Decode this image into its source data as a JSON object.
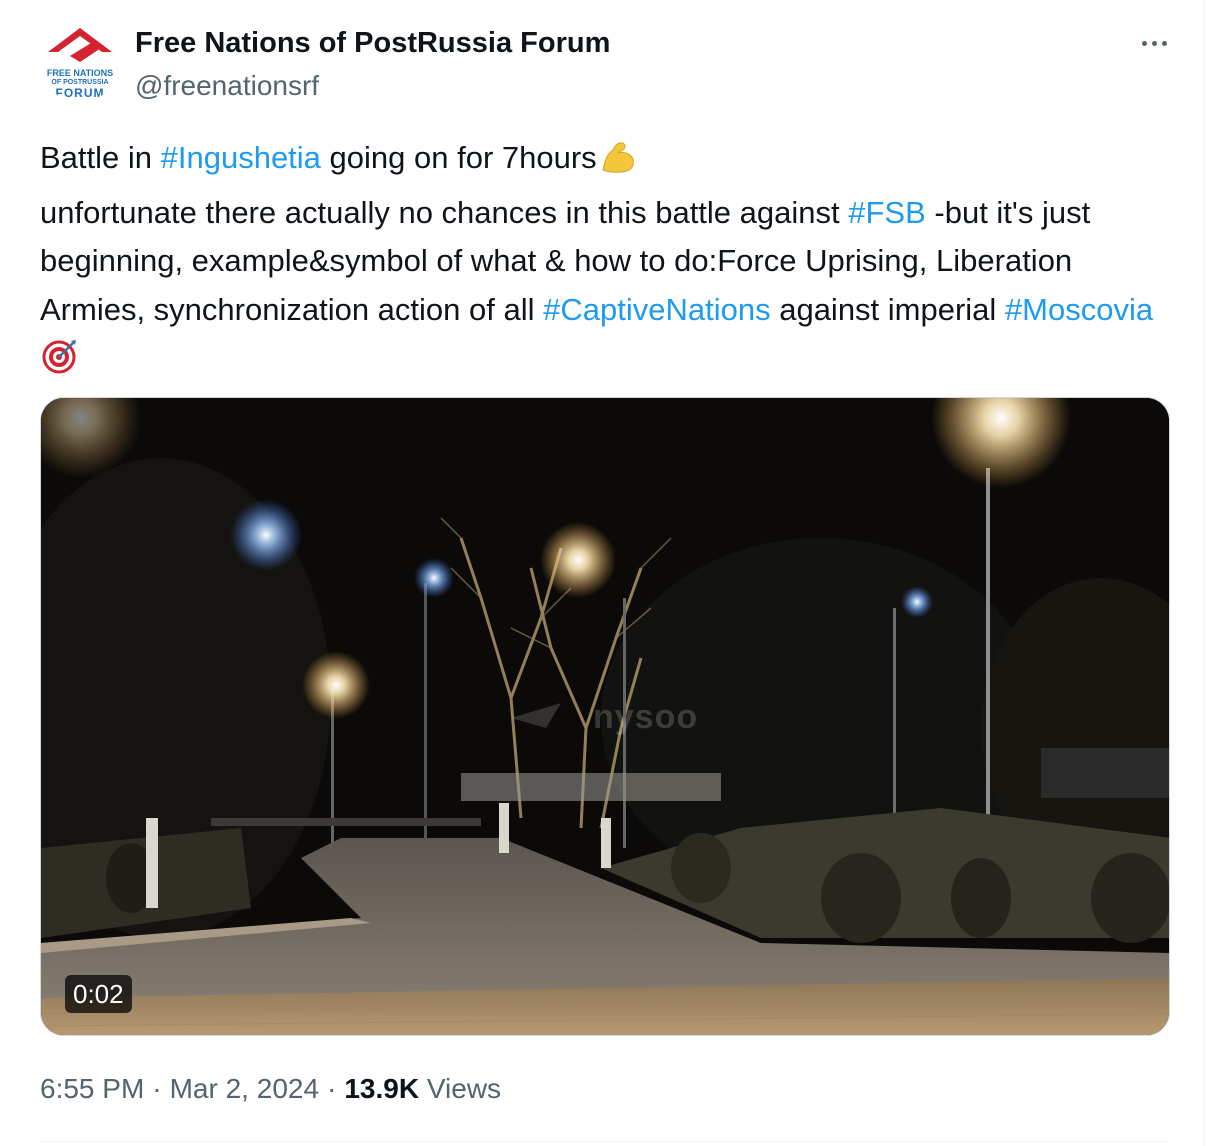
{
  "post": {
    "author_name": "Free Nations of PostRussia Forum",
    "handle": "@freenationsrf",
    "avatar_text": {
      "line1": "FREE NATIONS",
      "line2": "OF POSTRUSSIA",
      "line3": "FORUM"
    },
    "text": {
      "p1_pre": "Battle in ",
      "p1_tag": "#Ingushetia",
      "p1_post": " going on for 7hours",
      "p1_emoji": "flexed-biceps-icon",
      "line2_pre": "unfortunate there actually no chances in this battle against ",
      "line2_tag": "#FSB",
      "line2_post": " -but it's just beginning, example&symbol of what & how to do:Force Uprising, Liberation Armies, synchronization action of all ",
      "tag3": "#CaptiveNations",
      "post3": " against imperial ",
      "tag4": "#Moscovia",
      "end_emoji": "direct-hit-target-icon"
    },
    "media": {
      "duration": "0:02",
      "watermark": "nysoo"
    },
    "meta": {
      "time": "6:55 PM",
      "date": "Mar 2, 2024",
      "separator": "·",
      "views_count": "13.9K",
      "views_label": "Views"
    }
  },
  "colors": {
    "link": "#1d9bf0",
    "secondary_text": "#536471",
    "primary_text": "#0f1419",
    "logo_red": "#d5232f",
    "logo_blue": "#1d73b8"
  }
}
